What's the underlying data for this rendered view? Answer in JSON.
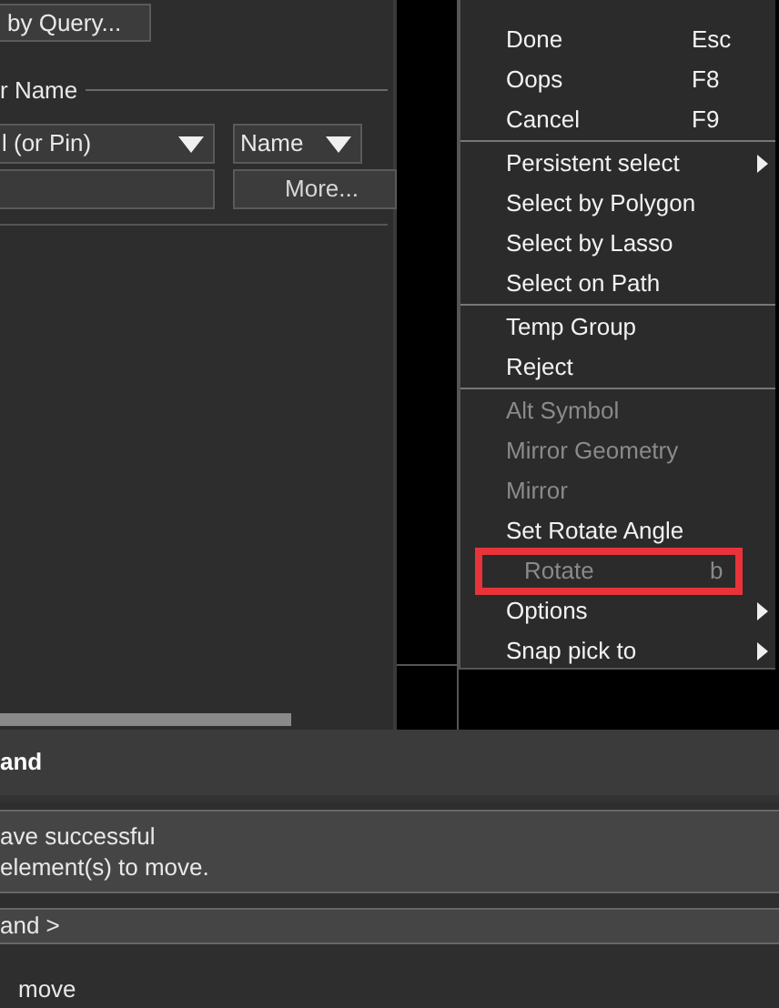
{
  "left_panel": {
    "query_button": "by Query...",
    "group_label": "r Name",
    "type_dropdown": "l (or Pin)",
    "field_dropdown": "Name",
    "more_button": "More..."
  },
  "context_menu": {
    "sections": [
      {
        "items": [
          {
            "label": "Done",
            "shortcut": "Esc",
            "disabled": false,
            "submenu": false,
            "marked": false
          },
          {
            "label": "Oops",
            "shortcut": "F8",
            "disabled": false,
            "submenu": false,
            "marked": false
          },
          {
            "label": "Cancel",
            "shortcut": "F9",
            "disabled": false,
            "submenu": false,
            "marked": false
          }
        ]
      },
      {
        "items": [
          {
            "label": "Persistent select",
            "disabled": false,
            "submenu": true,
            "marked": false
          },
          {
            "label": "Select by Polygon",
            "disabled": false,
            "submenu": false,
            "marked": false
          },
          {
            "label": "Select by Lasso",
            "disabled": false,
            "submenu": false,
            "marked": false
          },
          {
            "label": "Select on Path",
            "disabled": false,
            "submenu": false,
            "marked": false
          }
        ]
      },
      {
        "items": [
          {
            "label": "Temp Group",
            "disabled": false,
            "submenu": false,
            "marked": false
          },
          {
            "label": "Reject",
            "disabled": false,
            "submenu": false,
            "marked": false
          }
        ]
      },
      {
        "items": [
          {
            "label": "Alt Symbol",
            "disabled": true,
            "submenu": false,
            "marked": false
          },
          {
            "label": "Mirror Geometry",
            "disabled": true,
            "submenu": false,
            "marked": false
          },
          {
            "label": "Mirror",
            "disabled": true,
            "submenu": false,
            "marked": false
          },
          {
            "label": "Set Rotate Angle",
            "disabled": false,
            "submenu": false,
            "marked": false
          },
          {
            "label": "Rotate",
            "shortcut": "b",
            "disabled": true,
            "submenu": false,
            "marked": true
          },
          {
            "label": "Options",
            "disabled": false,
            "submenu": true,
            "marked": false
          },
          {
            "label": "Snap pick to",
            "disabled": false,
            "submenu": true,
            "marked": false
          }
        ]
      }
    ]
  },
  "command_panel": {
    "title": "and",
    "messages": [
      "ave successful",
      "element(s) to move."
    ],
    "prompt": "and >",
    "status": "move"
  }
}
